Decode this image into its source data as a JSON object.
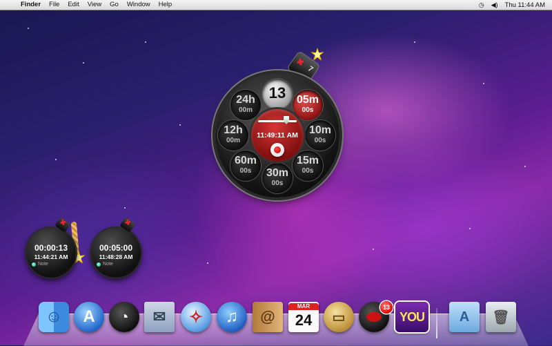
{
  "menubar": {
    "apple_icon": "",
    "app_name": "Finder",
    "menus": [
      "File",
      "Edit",
      "View",
      "Go",
      "Window",
      "Help"
    ],
    "status_icons": [
      "time-machine-icon",
      "volume-icon"
    ],
    "clock": "Thu 11:44 AM"
  },
  "dial_widget": {
    "count": "13",
    "presets": [
      {
        "big": "24h",
        "small": "00m"
      },
      {
        "big": "05m",
        "small": "00s"
      },
      {
        "big": "12h",
        "small": "00m"
      },
      {
        "big": "10m",
        "small": "00s"
      },
      {
        "big": "60m",
        "small": "00s"
      },
      {
        "big": "15m",
        "small": "00s"
      },
      {
        "big": "30m",
        "small": "00s"
      }
    ],
    "center_time": "11:49:11 AM",
    "cap_mark": "7"
  },
  "timers": [
    {
      "countdown": "00:00:13",
      "alarm_time": "11:44:21 AM",
      "note": "Note"
    },
    {
      "countdown": "00:05:00",
      "alarm_time": "11:48:28 AM",
      "note": "Note"
    }
  ],
  "dock": {
    "calendar_month": "MAR",
    "calendar_day": "24",
    "badge_count": "13",
    "you_label": "YOU",
    "items": [
      "finder-icon",
      "app-store-icon",
      "dashboard-icon",
      "mail-icon",
      "safari-icon",
      "itunes-icon",
      "address-book-icon",
      "ical-icon",
      "preview-icon",
      "bomb-timer-icon",
      "you-app-icon",
      "applications-folder-icon",
      "trash-icon"
    ]
  }
}
